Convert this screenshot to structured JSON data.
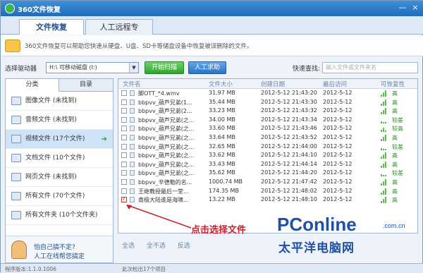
{
  "window": {
    "title": "360文件恢复",
    "min": "—",
    "close": "×"
  },
  "tabs": [
    {
      "label": "文件恢复"
    },
    {
      "label": "人工远程专家"
    }
  ],
  "info": {
    "text": "360文件恢复可以帮助您快速从硬盘、U盘、SD卡等储盘设备中恢复被误删除的文件。"
  },
  "drive": {
    "label": "选择驱动器",
    "value": "H:\\ 可移动磁盘 (I:)",
    "scan_btn": "开始扫描",
    "help_btn": "人工求助",
    "quick_label": "快速查找:",
    "quick_placeholder": "输入文件或文件夹名"
  },
  "left": {
    "tabs": [
      "分类",
      "目录"
    ],
    "items": [
      {
        "label": "图像文件 (未找到)"
      },
      {
        "label": "音频文件 (未找到)"
      },
      {
        "label": "视频文件 (17个文件)"
      },
      {
        "label": "文档文件 (10个文件)"
      },
      {
        "label": "网页文件 (未找到)"
      },
      {
        "label": "所有文件 (70个文件)"
      },
      {
        "label": "所有文件夹 (10个文件夹)"
      }
    ],
    "help": {
      "line1": "怕自己搞不定?",
      "line2": "人工在线帮您搞定"
    }
  },
  "grid": {
    "headers": [
      "文件名",
      "文件大小",
      "创建日期",
      "最后访问",
      "可恢复性"
    ],
    "rows": [
      {
        "name": "脚OTT_*4.wmv",
        "size": "31.97 MB",
        "created": "2012-5-12 21:43:20",
        "accessed": "2012-5-12",
        "status": "高"
      },
      {
        "name": "bbpvv_葫芦兄弟(1...",
        "size": "35.44 MB",
        "created": "2012-5-12 21:43:30",
        "accessed": "2012-5-12",
        "status": "高"
      },
      {
        "name": "bbpvv_葫芦兄弟(2...",
        "size": "33.23 MB",
        "created": "2012-5-12 21:43:32",
        "accessed": "2012-5-12",
        "status": "高"
      },
      {
        "name": "bbpvv_葫芦兄弟(之...",
        "size": "34.00 MB",
        "created": "2012-5-12 21:43:34",
        "accessed": "2012-5-12",
        "status": "较差"
      },
      {
        "name": "bbpvv_葫芦兄弟(之...",
        "size": "33.60 MB",
        "created": "2012-5-12 21:43:46",
        "accessed": "2012-5-12",
        "status": "较高"
      },
      {
        "name": "bbpvv_葫芦兄弟(之...",
        "size": "33.64 MB",
        "created": "2012-5-12 21:43:52",
        "accessed": "2012-5-12",
        "status": "高"
      },
      {
        "name": "bbpvv_葫芦兄弟(之...",
        "size": "32.65 MB",
        "created": "2012-5-12 21:44:00",
        "accessed": "2012-5-12",
        "status": "较差"
      },
      {
        "name": "bbpvv_葫芦兄弟(之...",
        "size": "33.62 MB",
        "created": "2012-5-12 21:44:10",
        "accessed": "2012-5-12",
        "status": "高"
      },
      {
        "name": "bbpvv_葫芦兄弟(之...",
        "size": "33.43 MB",
        "created": "2012-5-12 21:44:14",
        "accessed": "2012-5-12",
        "status": "高"
      },
      {
        "name": "bbpvv_葫芦兄弟(之...",
        "size": "35.62 MB",
        "created": "2012-5-12 21:44:20",
        "accessed": "2012-5-12",
        "status": "较差"
      },
      {
        "name": "bbpvv_辛德勒的名...",
        "size": "1000.74 MB",
        "created": "2012-5-12 21:47:42",
        "accessed": "2012-5-12",
        "status": "高"
      },
      {
        "name": "王继教授最后一堂...",
        "size": "174.35 MB",
        "created": "2012-5-12 21:48:02",
        "accessed": "2012-5-12",
        "status": "高"
      },
      {
        "name": "南极大陆谁是海啸...",
        "size": "13.22 MB",
        "created": "2012-5-12 21:48:10",
        "accessed": "2012-5-12",
        "status": "高"
      }
    ]
  },
  "footer": {
    "select_all": "全选",
    "select_none": "全不选",
    "invert": "反选"
  },
  "status": {
    "version": "程序版本:1.1.0.1006",
    "count": "此次检出17个项目"
  },
  "annotation": "点击选择文件",
  "watermark": {
    "logo": "PConline",
    "domain": ".com.cn",
    "cn": "太平洋电脑网"
  }
}
